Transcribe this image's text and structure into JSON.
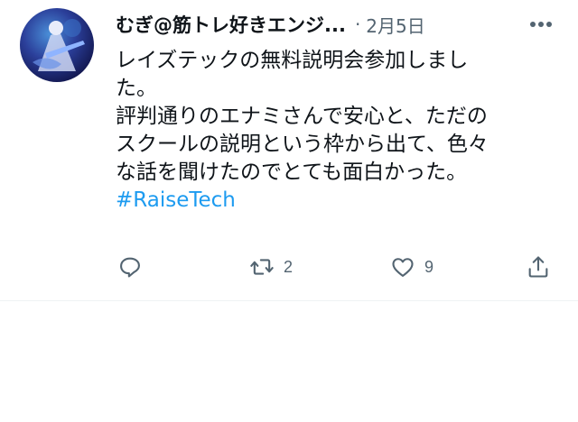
{
  "tweet": {
    "author_name": "むぎ@筋トレ好きエンジ...",
    "separator": "·",
    "date": "2月5日",
    "text_lines": [
      "レイズテックの無料説明会参加しまし",
      "た。",
      "評判通りのエナミさんで安心と、ただの",
      "スクールの説明という枠から出て、色々",
      "な話を聞けたのでとても面白かった。"
    ],
    "hashtag": "#RaiseTech",
    "actions": {
      "reply_icon": "reply-icon",
      "retweet_icon": "retweet-icon",
      "retweet_count": "2",
      "like_icon": "heart-icon",
      "like_count": "9",
      "share_icon": "share-icon"
    },
    "colors": {
      "text": "#0f1419",
      "secondary": "#536471",
      "link": "#1d9bf0"
    }
  }
}
